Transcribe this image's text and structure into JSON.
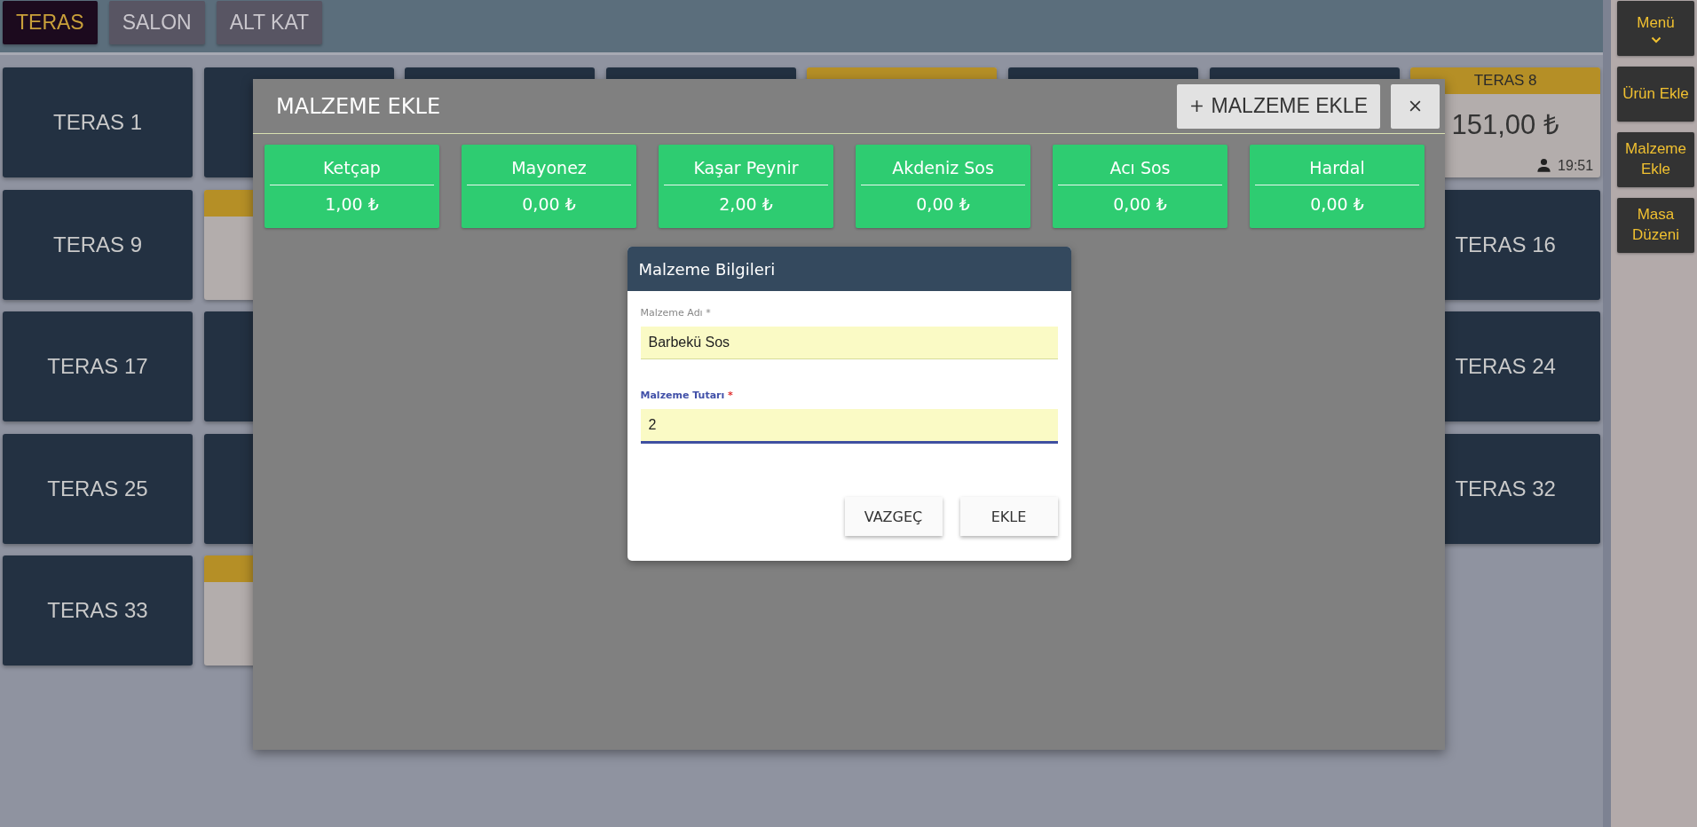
{
  "floor_tabs": [
    {
      "label": "TERAS",
      "selected": true
    },
    {
      "label": "SALON",
      "selected": false
    },
    {
      "label": "ALT KAT",
      "selected": false
    }
  ],
  "table_rows": [
    {
      "start": [
        {
          "kind": "free",
          "label": "TERAS 1"
        },
        {
          "kind": "free"
        },
        {
          "kind": "free"
        },
        {
          "kind": "free"
        },
        {
          "kind": "occupied"
        },
        {
          "kind": "free"
        },
        {
          "kind": "free"
        },
        {
          "kind": "occupied",
          "label": "TERAS 8",
          "amount": "151,00 ₺",
          "time": "19:51"
        }
      ],
      "end": []
    },
    {
      "start": [
        {
          "kind": "free",
          "label": "TERAS 9"
        },
        {
          "kind": "occupied"
        }
      ],
      "end": [
        {
          "kind": "free",
          "label": "TERAS 16"
        }
      ]
    },
    {
      "start": [
        {
          "kind": "free",
          "label": "TERAS 17"
        },
        {
          "kind": "free"
        }
      ],
      "end": [
        {
          "kind": "free",
          "label": "TERAS 24"
        }
      ]
    },
    {
      "start": [
        {
          "kind": "free",
          "label": "TERAS 25"
        },
        {
          "kind": "free"
        }
      ],
      "end": [
        {
          "kind": "free",
          "label": "TERAS 32"
        }
      ]
    },
    {
      "start": [
        {
          "kind": "free",
          "label": "TERAS 33"
        },
        {
          "kind": "occupied"
        }
      ],
      "end": []
    }
  ],
  "sidebar": [
    {
      "label": "Menü",
      "kind": "dropdown"
    },
    {
      "label": "Ürün Ekle",
      "kind": "button"
    },
    {
      "label": "Malzeme Ekle",
      "kind": "button"
    },
    {
      "label": "Masa Düzeni",
      "kind": "button"
    }
  ],
  "modal": {
    "title": "MALZEME EKLE",
    "add_button": "MALZEME EKLE",
    "ingredients": [
      {
        "name": "Ketçap",
        "price": "1,00 ₺"
      },
      {
        "name": "Mayonez",
        "price": "0,00 ₺"
      },
      {
        "name": "Kaşar Peynir",
        "price": "2,00 ₺"
      },
      {
        "name": "Akdeniz Sos",
        "price": "0,00 ₺"
      },
      {
        "name": "Acı Sos",
        "price": "0,00 ₺"
      },
      {
        "name": "Hardal",
        "price": "0,00 ₺"
      }
    ],
    "dialog": {
      "title": "Malzeme Bilgileri",
      "fields": [
        {
          "label": "Malzeme Adı",
          "required_mark": "*",
          "value": "Barbekü Sos",
          "focused": false
        },
        {
          "label": "Malzeme Tutarı",
          "required_mark": "*",
          "value": "2",
          "focused": true
        }
      ],
      "buttons": [
        "VAZGEÇ",
        "EKLE"
      ]
    }
  }
}
